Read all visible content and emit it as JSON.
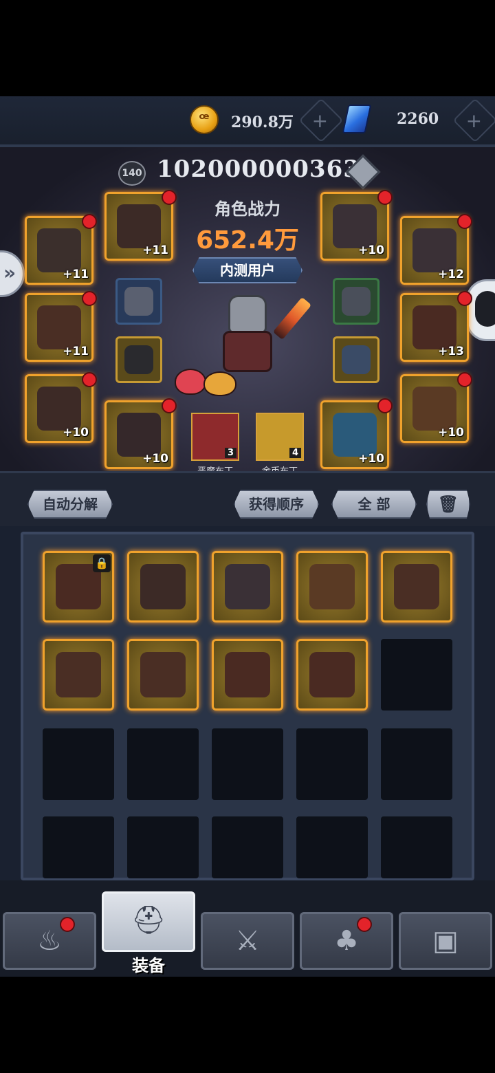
{
  "resources": {
    "gold": "290.8万",
    "gems": "2260"
  },
  "profile": {
    "level": "140",
    "uid": "102000000363",
    "power_label": "角色战力",
    "power_value": "652.4万",
    "tag": "内测用户"
  },
  "equipment_slots": [
    {
      "lvl": "+11"
    },
    {
      "lvl": "+11"
    },
    {
      "lvl": "+10"
    },
    {
      "lvl": "+12"
    },
    {
      "lvl": "+11"
    },
    {
      "lvl": "+13"
    },
    {
      "lvl": "+10"
    },
    {
      "lvl": "+10"
    },
    {
      "lvl": "+10"
    },
    {
      "lvl": "+10"
    }
  ],
  "pets": [
    {
      "name": "恶魔布丁",
      "count": "3"
    },
    {
      "name": "金币布丁",
      "count": "4"
    }
  ],
  "toolbar": {
    "decompose": "自动分解",
    "sort": "获得顺序",
    "filter": "全 部"
  },
  "nav": {
    "active_label": "装备"
  },
  "icons": [
    "coin-icon",
    "gem-icon",
    "trash-icon",
    "lock-icon",
    "campfire-icon",
    "helmet-icon",
    "swords-icon",
    "tree-icon",
    "chest-icon"
  ]
}
